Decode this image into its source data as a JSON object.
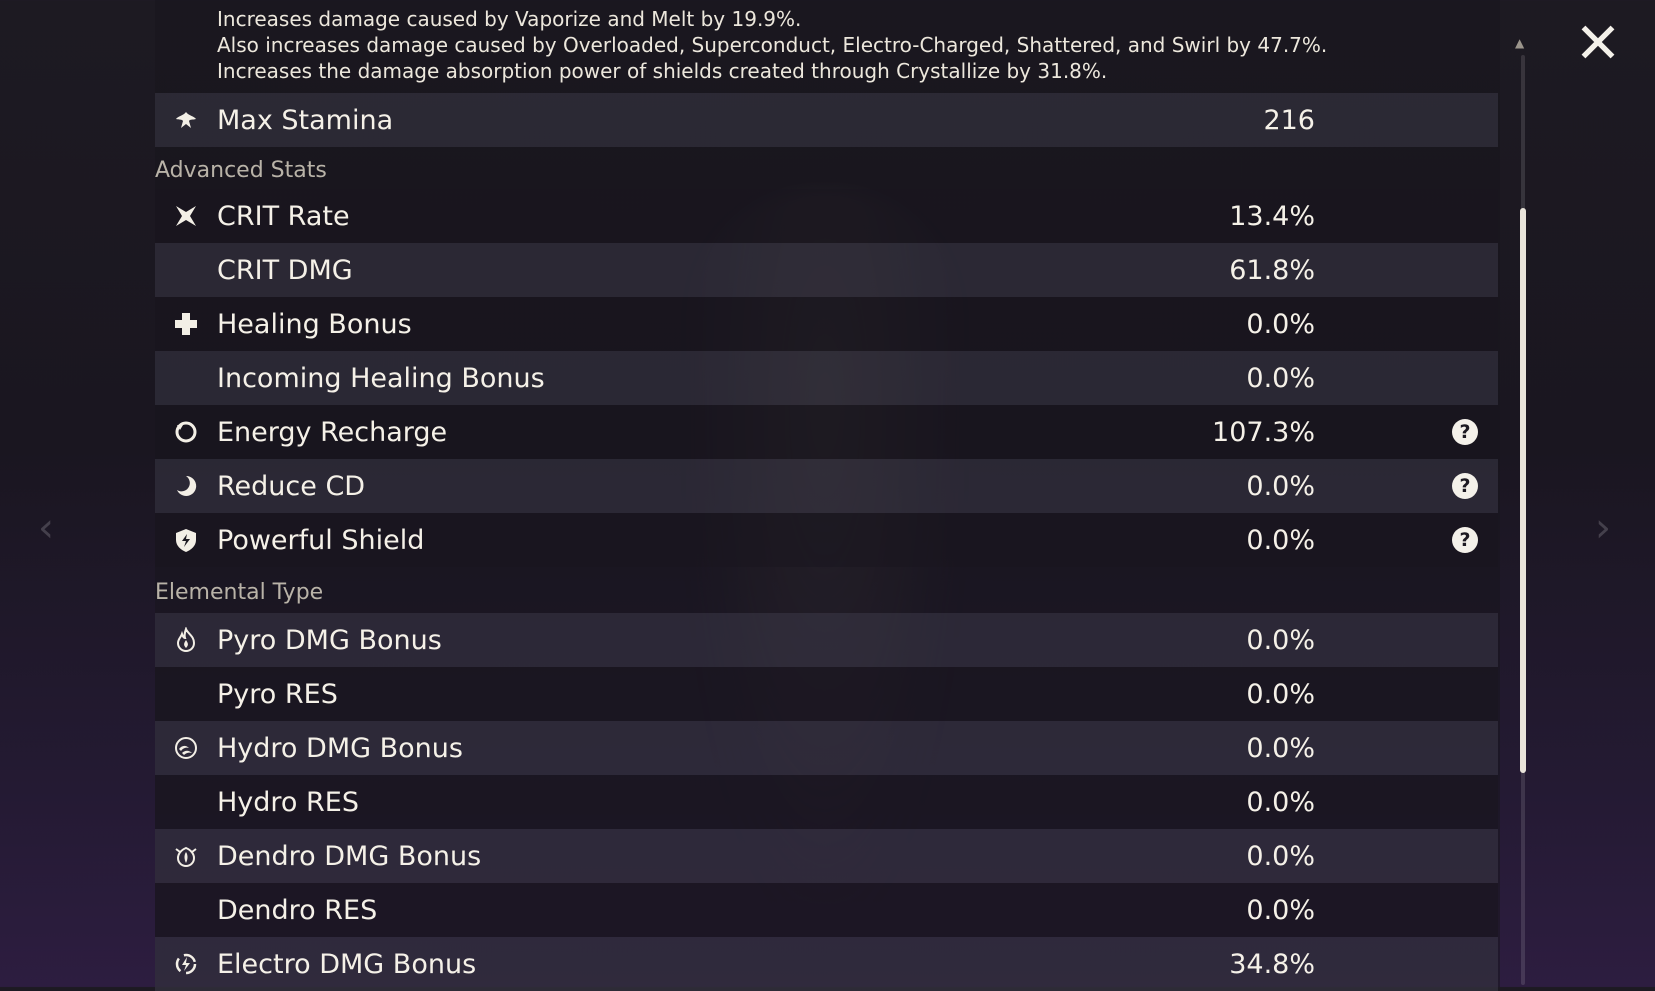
{
  "description": [
    "Increases damage caused by Vaporize and Melt by 19.9%.",
    "Also increases damage caused by Overloaded, Superconduct, Electro-Charged, Shattered, and Swirl by 47.7%.",
    "Increases the damage absorption power of shields created through Crystallize by 31.8%."
  ],
  "max_stamina": {
    "label": "Max Stamina",
    "value": "216",
    "icon": "stamina-icon"
  },
  "sections": {
    "advanced": "Advanced Stats",
    "elemental": "Elemental Type"
  },
  "advanced_stats": [
    {
      "label": "CRIT Rate",
      "value": "13.4%",
      "icon": "crit-rate-icon"
    },
    {
      "label": "CRIT DMG",
      "value": "61.8%",
      "icon": ""
    },
    {
      "label": "Healing Bonus",
      "value": "0.0%",
      "icon": "healing-icon"
    },
    {
      "label": "Incoming Healing Bonus",
      "value": "0.0%",
      "icon": ""
    },
    {
      "label": "Energy Recharge",
      "value": "107.3%",
      "icon": "energy-recharge-icon",
      "help": "?"
    },
    {
      "label": "Reduce CD",
      "value": "0.0%",
      "icon": "cooldown-icon",
      "help": "?"
    },
    {
      "label": "Powerful Shield",
      "value": "0.0%",
      "icon": "shield-icon",
      "help": "?"
    }
  ],
  "elemental_stats": [
    {
      "label": "Pyro DMG Bonus",
      "value": "0.0%",
      "icon": "pyro-icon"
    },
    {
      "label": "Pyro RES",
      "value": "0.0%",
      "icon": ""
    },
    {
      "label": "Hydro DMG Bonus",
      "value": "0.0%",
      "icon": "hydro-icon"
    },
    {
      "label": "Hydro RES",
      "value": "0.0%",
      "icon": ""
    },
    {
      "label": "Dendro DMG Bonus",
      "value": "0.0%",
      "icon": "dendro-icon"
    },
    {
      "label": "Dendro RES",
      "value": "0.0%",
      "icon": ""
    },
    {
      "label": "Electro DMG Bonus",
      "value": "34.8%",
      "icon": "electro-icon"
    }
  ],
  "close_icon": "close-icon"
}
